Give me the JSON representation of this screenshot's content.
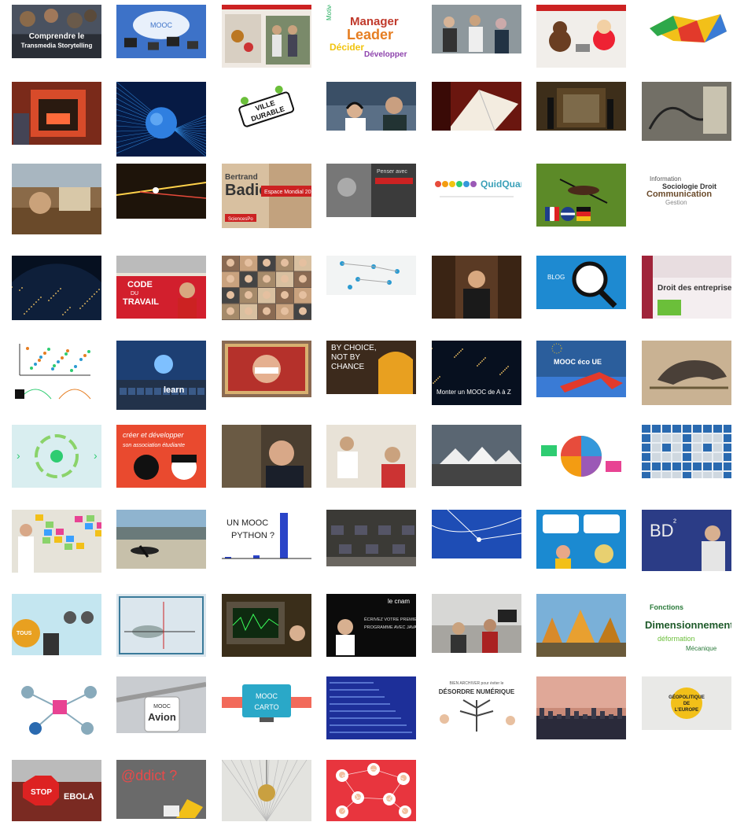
{
  "page": {
    "background": "#ffffff"
  },
  "thumbnails": [
    {
      "caption": "Comprendre le Transmedia Storytelling",
      "icon": "course-thumbnail-storytelling",
      "bg": "#2a2e36"
    },
    {
      "caption": "MOOC",
      "icon": "course-thumbnail-mooc-cloud",
      "bg": "#3d72c8"
    },
    {
      "caption": "",
      "icon": "course-thumbnail-people-red",
      "bg": "#efe9e2"
    },
    {
      "caption": "Manager Leader Décider Développer",
      "icon": "course-thumbnail-word-cloud",
      "bg": "#ffffff"
    },
    {
      "caption": "",
      "icon": "course-thumbnail-office-photo",
      "bg": "#6d7a80"
    },
    {
      "caption": "",
      "icon": "course-thumbnail-toys",
      "bg": "#f1eeea"
    },
    {
      "caption": "",
      "icon": "course-thumbnail-puzzle-map",
      "bg": "#ffffff"
    },
    {
      "caption": "",
      "icon": "course-thumbnail-3d-printer",
      "bg": "#b84a2a"
    },
    {
      "caption": "",
      "icon": "course-thumbnail-globe-fibers",
      "bg": "#0a2a66"
    },
    {
      "caption": "VILLE DURABLE",
      "icon": "course-thumbnail-ville-durable",
      "bg": "#ffffff"
    },
    {
      "caption": "",
      "icon": "course-thumbnail-students-headphones",
      "bg": "#5a6f86"
    },
    {
      "caption": "",
      "icon": "course-thumbnail-book-reading",
      "bg": "#7a1c14"
    },
    {
      "caption": "",
      "icon": "course-thumbnail-museum-hall",
      "bg": "#4d3c24"
    },
    {
      "caption": "",
      "icon": "course-thumbnail-engraving",
      "bg": "#7d7b72"
    },
    {
      "caption": "",
      "icon": "course-thumbnail-painting",
      "bg": "#7d5a3a"
    },
    {
      "caption": "",
      "icon": "course-thumbnail-laser",
      "bg": "#2b1c10"
    },
    {
      "caption": "Bertrand Badie — Espace Mondial 2014",
      "icon": "course-thumbnail-badie",
      "bg": "#d9c2a4"
    },
    {
      "caption": "",
      "icon": "course-thumbnail-humanities",
      "bg": "#3b3b3b"
    },
    {
      "caption": "QuidQuam?",
      "icon": "course-thumbnail-quidquam",
      "bg": "#ffffff"
    },
    {
      "caption": "",
      "icon": "course-thumbnail-mosquito-flags",
      "bg": "#5c8a28"
    },
    {
      "caption": "",
      "icon": "course-thumbnail-terms-cloud",
      "bg": "#ffffff"
    },
    {
      "caption": "",
      "icon": "course-thumbnail-earth-night",
      "bg": "#06101f"
    },
    {
      "caption": "CODE DU TRAVAIL",
      "icon": "course-thumbnail-code-travail",
      "bg": "#d21f2d"
    },
    {
      "caption": "",
      "icon": "course-thumbnail-faces-grid",
      "bg": "#6b5a4d"
    },
    {
      "caption": "",
      "icon": "course-thumbnail-network-slide",
      "bg": "#f2f4f4"
    },
    {
      "caption": "",
      "icon": "course-thumbnail-presenter-library",
      "bg": "#5a3a24"
    },
    {
      "caption": "BLOG",
      "icon": "course-thumbnail-blog-magnifier",
      "bg": "#1e8ad1"
    },
    {
      "caption": "Droit des entreprises",
      "icon": "course-thumbnail-droit-entreprises",
      "bg": "#f4eef0"
    },
    {
      "caption": "",
      "icon": "course-thumbnail-scatter-plot",
      "bg": "#ffffff"
    },
    {
      "caption": "learn",
      "icon": "course-thumbnail-learn-keyboard",
      "bg": "#1d3f73"
    },
    {
      "caption": "",
      "icon": "course-thumbnail-mao-portrait",
      "bg": "#b5312b"
    },
    {
      "caption": "BY CHOICE, NOT BY CHANCE",
      "icon": "course-thumbnail-by-choice",
      "bg": "#3c2a1c"
    },
    {
      "caption": "Monter un MOOC de A à Z",
      "icon": "course-thumbnail-mooc-a-z",
      "bg": "#07101f"
    },
    {
      "caption": "MOOC éco UE",
      "icon": "course-thumbnail-mooc-eco-ue",
      "bg": "#2b5e9c"
    },
    {
      "caption": "",
      "icon": "course-thumbnail-crow",
      "bg": "#c9b293"
    },
    {
      "caption": "",
      "icon": "course-thumbnail-recycle-cycle",
      "bg": "#d9eef0"
    },
    {
      "caption": "créer et développer son association étudiante",
      "icon": "course-thumbnail-association",
      "bg": "#e94a2f"
    },
    {
      "caption": "",
      "icon": "course-thumbnail-man-portrait",
      "bg": "#5c4e3c"
    },
    {
      "caption": "",
      "icon": "course-thumbnail-lab-students",
      "bg": "#e8e2d7"
    },
    {
      "caption": "",
      "icon": "course-thumbnail-tents",
      "bg": "#4d5a66"
    },
    {
      "caption": "",
      "icon": "course-thumbnail-colorful-globe",
      "bg": "#ffffff"
    },
    {
      "caption": "",
      "icon": "course-thumbnail-pattern-grid",
      "bg": "#e9eef3"
    },
    {
      "caption": "",
      "icon": "course-thumbnail-sticky-notes",
      "bg": "#e6e3d9"
    },
    {
      "caption": "",
      "icon": "course-thumbnail-beach",
      "bg": "#8fb4cf"
    },
    {
      "caption": "UN MOOC PYTHON ?",
      "icon": "course-thumbnail-mooc-python",
      "bg": "#ffffff"
    },
    {
      "caption": "",
      "icon": "course-thumbnail-computer-room",
      "bg": "#3b3a36"
    },
    {
      "caption": "",
      "icon": "course-thumbnail-blue-lines",
      "bg": "#1e4db5"
    },
    {
      "caption": "",
      "icon": "course-thumbnail-cartoon",
      "bg": "#1b8ad1"
    },
    {
      "caption": "BD²",
      "icon": "course-thumbnail-bd2",
      "bg": "#2b3c86"
    },
    {
      "caption": "",
      "icon": "course-thumbnail-skull-sign",
      "bg": "#c4e6f0"
    },
    {
      "caption": "",
      "icon": "course-thumbnail-physics-diagram",
      "bg": "#dbe6ed"
    },
    {
      "caption": "",
      "icon": "course-thumbnail-oscilloscope",
      "bg": "#5a4a2a"
    },
    {
      "caption": "le cnam — Écrivez votre premier programme avec Java",
      "icon": "course-thumbnail-java",
      "bg": "#0b0b0b"
    },
    {
      "caption": "",
      "icon": "course-thumbnail-classroom",
      "bg": "#d7d7d5"
    },
    {
      "caption": "",
      "icon": "course-thumbnail-autumn-trees",
      "bg": "#c88a2a"
    },
    {
      "caption": "Dimensionnement",
      "icon": "course-thumbnail-dimensionnement",
      "bg": "#ffffff"
    },
    {
      "caption": "",
      "icon": "course-thumbnail-molecules",
      "bg": "#ffffff"
    },
    {
      "caption": "MOOC Avion",
      "icon": "course-thumbnail-mooc-avion",
      "bg": "#c9ccd0"
    },
    {
      "caption": "MOOC CARTO",
      "icon": "course-thumbnail-mooc-carto",
      "bg": "#ffffff"
    },
    {
      "caption": "",
      "icon": "course-thumbnail-blue-text",
      "bg": "#1d2f99"
    },
    {
      "caption": "BIEN ARCHIVER pour éviter le DÉSORDRE NUMÉRIQUE",
      "icon": "course-thumbnail-desordre",
      "bg": "#ffffff"
    },
    {
      "caption": "",
      "icon": "course-thumbnail-city-dusk",
      "bg": "#c98a78"
    },
    {
      "caption": "GÉOPOLITIQUE DE L'EUROPE",
      "icon": "course-thumbnail-geopolitique",
      "bg": "#e9e9e7"
    },
    {
      "caption": "STOP EBOLA",
      "icon": "course-thumbnail-stop-ebola",
      "bg": "#7a2a22"
    },
    {
      "caption": "@ddict ?",
      "icon": "course-thumbnail-addict",
      "bg": "#6a6a6a"
    },
    {
      "caption": "",
      "icon": "course-thumbnail-pendulum",
      "bg": "#e3e3df"
    },
    {
      "caption": "",
      "icon": "course-thumbnail-people-network",
      "bg": "#e8353e"
    }
  ]
}
